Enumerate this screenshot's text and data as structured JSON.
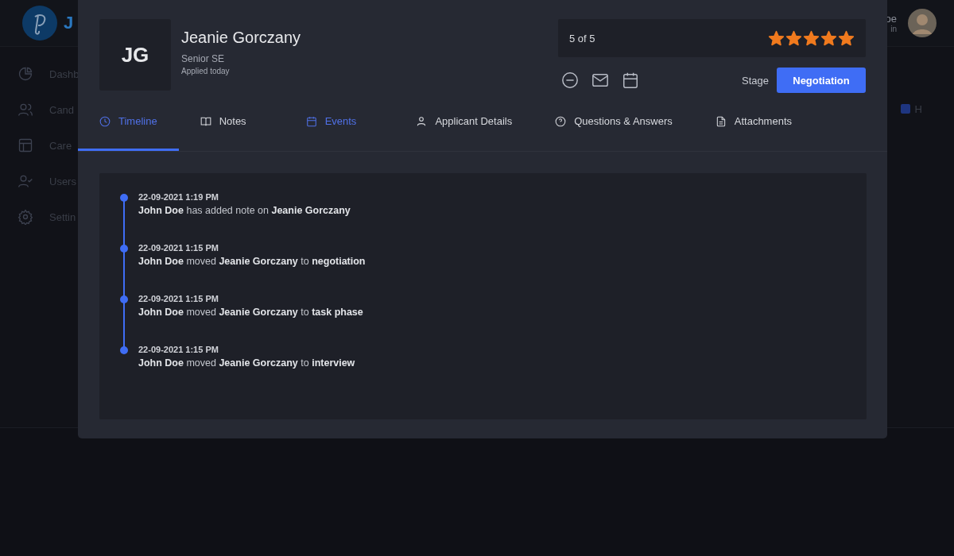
{
  "background": {
    "logo_text": "J",
    "user_name": "oe",
    "user_role": "in",
    "legend_label": "H",
    "sidebar": [
      {
        "label": "Dashb"
      },
      {
        "label": "Cand"
      },
      {
        "label": "Care"
      },
      {
        "label": "Users"
      },
      {
        "label": "Settin"
      }
    ]
  },
  "candidate": {
    "initials": "JG",
    "name": "Jeanie Gorczany",
    "position": "Senior SE",
    "applied": "Applied today"
  },
  "rating": {
    "label": "5 of 5",
    "stars": 5
  },
  "stage": {
    "label": "Stage",
    "value": "Negotiation"
  },
  "actions": [
    {
      "kind": "minus"
    },
    {
      "kind": "mail"
    },
    {
      "kind": "calendar"
    }
  ],
  "tabs": [
    {
      "label": "Timeline",
      "selected": true,
      "highlighted": true
    },
    {
      "label": "Notes",
      "selected": false,
      "highlighted": false
    },
    {
      "label": "Events",
      "selected": false,
      "highlighted": true
    },
    {
      "label": "Applicant Details",
      "selected": false,
      "highlighted": false
    },
    {
      "label": "Questions & Answers",
      "selected": false,
      "highlighted": false
    },
    {
      "label": "Attachments",
      "selected": false,
      "highlighted": false
    }
  ],
  "timeline": [
    {
      "time": "22-09-2021 1:19 PM",
      "text": "**John Doe** has added note on **Jeanie Gorczany**"
    },
    {
      "time": "22-09-2021 1:15 PM",
      "text": "**John Doe** moved **Jeanie Gorczany** to **negotiation**"
    },
    {
      "time": "22-09-2021 1:15 PM",
      "text": "**John Doe** moved **Jeanie Gorczany** to **task phase**"
    },
    {
      "time": "22-09-2021 1:15 PM",
      "text": "**John Doe** moved **Jeanie Gorczany** to **interview**"
    }
  ]
}
